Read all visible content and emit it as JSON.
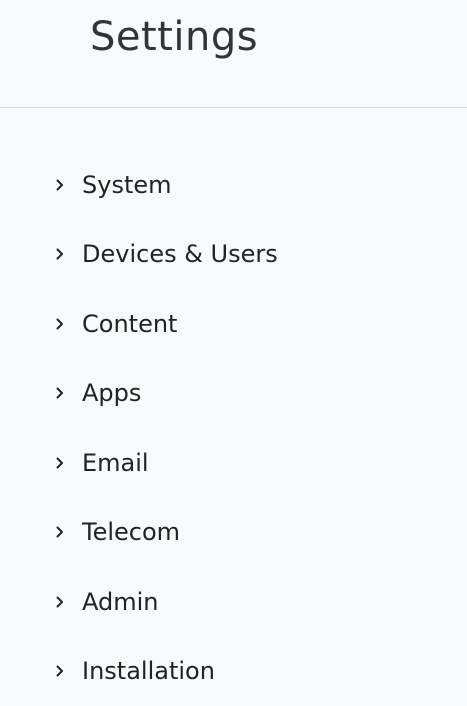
{
  "header": {
    "title": "Settings"
  },
  "menu": {
    "items": [
      {
        "label": "System",
        "icon": "chevron-right-icon"
      },
      {
        "label": "Devices & Users",
        "icon": "chevron-right-icon"
      },
      {
        "label": "Content",
        "icon": "chevron-right-icon"
      },
      {
        "label": "Apps",
        "icon": "chevron-right-icon"
      },
      {
        "label": "Email",
        "icon": "chevron-right-icon"
      },
      {
        "label": "Telecom",
        "icon": "chevron-right-icon"
      },
      {
        "label": "Admin",
        "icon": "chevron-right-icon"
      },
      {
        "label": "Installation",
        "icon": "chevron-right-icon"
      }
    ]
  },
  "colors": {
    "background": "#f8f9fb",
    "text": "#222327",
    "title": "#333438",
    "divider": "#d8dadd"
  }
}
